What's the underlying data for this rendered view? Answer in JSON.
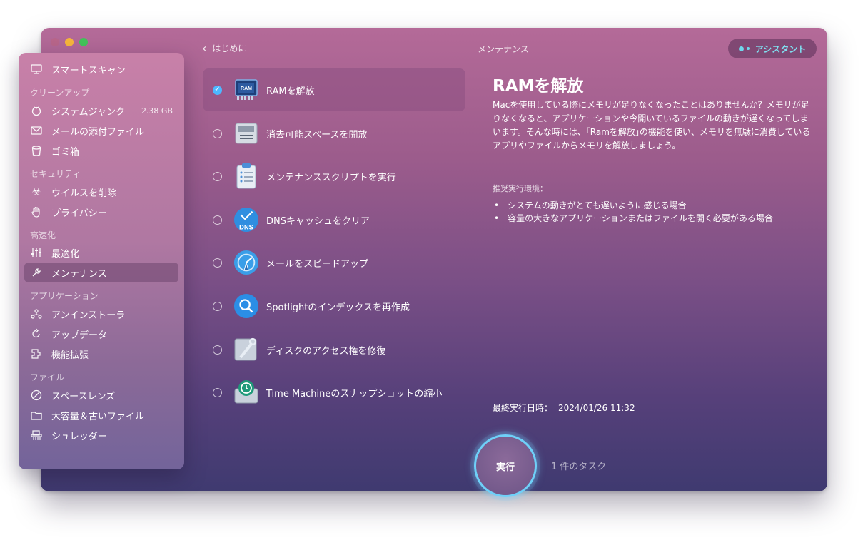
{
  "window": {
    "title": "メンテナンス"
  },
  "nav": {
    "back_label": "はじめに"
  },
  "assistant_label": "アシスタント",
  "sidebar": {
    "top_item": {
      "label": "スマートスキャン",
      "icon": "monitor-icon"
    },
    "sections": [
      {
        "title": "クリーンアップ",
        "items": [
          {
            "label": "システムジャンク",
            "icon": "trash-drum-icon",
            "badge": "2.38 GB"
          },
          {
            "label": "メールの添付ファイル",
            "icon": "envelope-icon"
          },
          {
            "label": "ゴミ箱",
            "icon": "bin-icon"
          }
        ]
      },
      {
        "title": "セキュリティ",
        "items": [
          {
            "label": "ウイルスを削除",
            "icon": "biohazard-icon"
          },
          {
            "label": "プライバシー",
            "icon": "hand-icon"
          }
        ]
      },
      {
        "title": "高速化",
        "items": [
          {
            "label": "最適化",
            "icon": "sliders-icon"
          },
          {
            "label": "メンテナンス",
            "icon": "wrench-icon",
            "active": true
          }
        ]
      },
      {
        "title": "アプリケーション",
        "items": [
          {
            "label": "アンインストーラ",
            "icon": "uninstaller-icon"
          },
          {
            "label": "アップデータ",
            "icon": "updater-icon"
          },
          {
            "label": "機能拡張",
            "icon": "extensions-icon"
          }
        ]
      },
      {
        "title": "ファイル",
        "items": [
          {
            "label": "スペースレンズ",
            "icon": "space-lens-icon"
          },
          {
            "label": "大容量＆古いファイル",
            "icon": "folder-icon"
          },
          {
            "label": "シュレッダー",
            "icon": "shredder-icon"
          }
        ]
      }
    ]
  },
  "tasks": [
    {
      "label": "RAMを解放",
      "checked": true,
      "icon": "ram-chip-icon"
    },
    {
      "label": "消去可能スペースを開放",
      "checked": false,
      "icon": "disk-drive-icon"
    },
    {
      "label": "メンテナンススクリプトを実行",
      "checked": false,
      "icon": "clipboard-icon"
    },
    {
      "label": "DNSキャッシュをクリア",
      "checked": false,
      "icon": "dns-icon"
    },
    {
      "label": "メールをスピードアップ",
      "checked": false,
      "icon": "mail-speed-icon"
    },
    {
      "label": "Spotlightのインデックスを再作成",
      "checked": false,
      "icon": "spotlight-icon"
    },
    {
      "label": "ディスクのアクセス権を修復",
      "checked": false,
      "icon": "disk-repair-icon"
    },
    {
      "label": "Time Machineのスナップショットの縮小",
      "checked": false,
      "icon": "time-machine-icon"
    }
  ],
  "detail": {
    "title": "RAMを解放",
    "description": "Macを使用している際にメモリが足りなくなったことはありませんか？メモリが足りなくなると、アプリケーションや今開いているファイルの動きが遅くなってしまいます。そんな時には、｢Ramを解放｣の機能を使い、メモリを無駄に消費しているアプリやファイルからメモリを解放しましょう。",
    "recommended_label": "推奨実行環境：",
    "recommended": [
      "システムの動きがとても遅いように感じる場合",
      "容量の大きなアプリケーションまたはファイルを開く必要がある場合"
    ],
    "last_run_label": "最終実行日時：",
    "last_run_value": "2024/01/26 11:32"
  },
  "run_button_label": "実行",
  "task_count_label": "1 件のタスク",
  "colors": {
    "accent": "#6fd0f8",
    "check": "#4db8ff"
  }
}
